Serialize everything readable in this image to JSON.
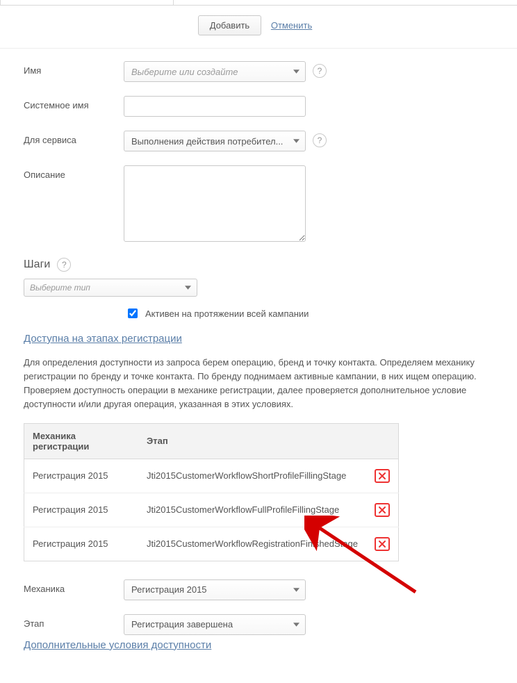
{
  "actions": {
    "add": "Добавить",
    "cancel": "Отменить"
  },
  "fields": {
    "name_label": "Имя",
    "name_placeholder": "Выберите или создайте",
    "sysname_label": "Системное имя",
    "sysname_value": "",
    "service_label": "Для сервиса",
    "service_value": "Выполнения действия потребител...",
    "description_label": "Описание",
    "description_value": ""
  },
  "steps": {
    "title": "Шаги",
    "type_placeholder": "Выберите тип",
    "active_checkbox": "Активен на протяжении всей кампании",
    "active_checked": true
  },
  "availability": {
    "heading": "Доступна на этапах регистрации",
    "paragraph": "Для определения доступности из запроса берем операцию, бренд и точку контакта. Определяем механику регистрации по бренду и точке контакта. По бренду поднимаем активные кампании, в них ищем операцию. Проверяем доступность операции в механике регистрации, далее проверяется дополнительное условие доступности и/или другая операция, указанная в этих условиях.",
    "table": {
      "col_mechanic": "Механика регистрации",
      "col_stage": "Этап",
      "rows": [
        {
          "mechanic": "Регистрация 2015",
          "stage": "Jti2015CustomerWorkflowShortProfileFillingStage"
        },
        {
          "mechanic": "Регистрация 2015",
          "stage": "Jti2015CustomerWorkflowFullProfileFillingStage"
        },
        {
          "mechanic": "Регистрация 2015",
          "stage": "Jti2015CustomerWorkflowRegistrationFinishedStage"
        }
      ]
    }
  },
  "selectors": {
    "mechanic_label": "Механика",
    "mechanic_value": "Регистрация 2015",
    "stage_label": "Этап",
    "stage_value": "Регистрация завершена"
  },
  "extra_heading": "Дополнительные условия доступности"
}
